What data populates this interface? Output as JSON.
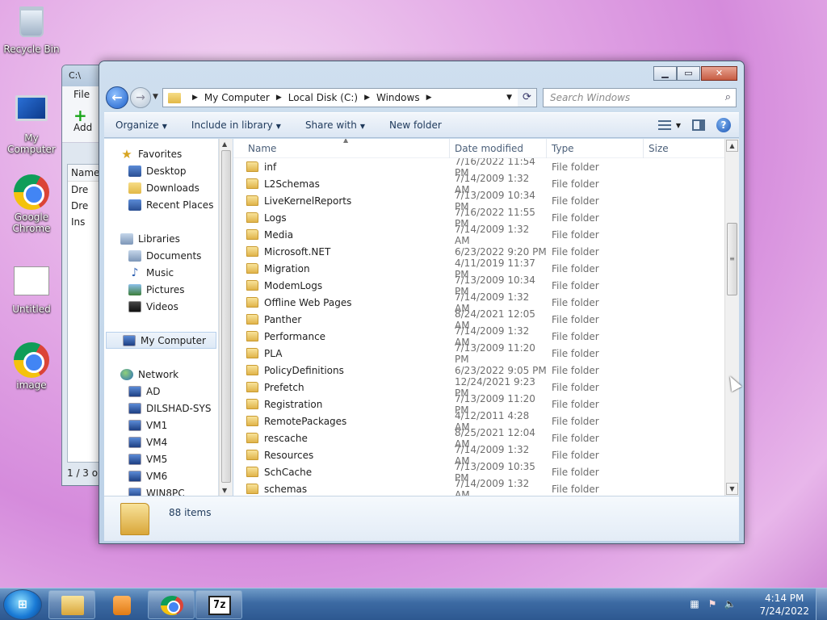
{
  "desktop": {
    "icons": [
      {
        "label": "Recycle Bin",
        "icon": "recycle-bin-icon"
      },
      {
        "label": "My Computer",
        "icon": "computer-icon"
      },
      {
        "label": "Google Chrome",
        "icon": "chrome-icon"
      },
      {
        "label": "Untitled",
        "icon": "document-icon"
      },
      {
        "label": "image",
        "icon": "chrome-icon"
      }
    ]
  },
  "backWindow": {
    "title": "C:\\",
    "menu": "File",
    "addLabel": "Add",
    "listHeader": "Name",
    "items": [
      "Dre",
      "Dre",
      "Ins"
    ],
    "status": "1 / 3 ob"
  },
  "explorer": {
    "address": {
      "crumbs": [
        "My Computer",
        "Local Disk (C:)",
        "Windows"
      ]
    },
    "search": {
      "placeholder": "Search Windows"
    },
    "commands": [
      "Organize",
      "Include in library",
      "Share with",
      "New folder"
    ],
    "nav": {
      "favorites": {
        "label": "Favorites",
        "items": [
          "Desktop",
          "Downloads",
          "Recent Places"
        ]
      },
      "libraries": {
        "label": "Libraries",
        "items": [
          "Documents",
          "Music",
          "Pictures",
          "Videos"
        ]
      },
      "computer": {
        "label": "My Computer"
      },
      "network": {
        "label": "Network",
        "items": [
          "AD",
          "DILSHAD-SYS",
          "VM1",
          "VM4",
          "VM5",
          "VM6",
          "WIN8PC"
        ]
      }
    },
    "columns": {
      "name": "Name",
      "date": "Date modified",
      "type": "Type",
      "size": "Size"
    },
    "files": [
      {
        "name": "inf",
        "date": "7/16/2022 11:54 PM",
        "type": "File folder"
      },
      {
        "name": "L2Schemas",
        "date": "7/14/2009 1:32 AM",
        "type": "File folder"
      },
      {
        "name": "LiveKernelReports",
        "date": "7/13/2009 10:34 PM",
        "type": "File folder"
      },
      {
        "name": "Logs",
        "date": "7/16/2022 11:55 PM",
        "type": "File folder"
      },
      {
        "name": "Media",
        "date": "7/14/2009 1:32 AM",
        "type": "File folder"
      },
      {
        "name": "Microsoft.NET",
        "date": "6/23/2022 9:20 PM",
        "type": "File folder"
      },
      {
        "name": "Migration",
        "date": "4/11/2019 11:37 PM",
        "type": "File folder"
      },
      {
        "name": "ModemLogs",
        "date": "7/13/2009 10:34 PM",
        "type": "File folder"
      },
      {
        "name": "Offline Web Pages",
        "date": "7/14/2009 1:32 AM",
        "type": "File folder"
      },
      {
        "name": "Panther",
        "date": "8/24/2021 12:05 AM",
        "type": "File folder"
      },
      {
        "name": "Performance",
        "date": "7/14/2009 1:32 AM",
        "type": "File folder"
      },
      {
        "name": "PLA",
        "date": "7/13/2009 11:20 PM",
        "type": "File folder"
      },
      {
        "name": "PolicyDefinitions",
        "date": "6/23/2022 9:05 PM",
        "type": "File folder"
      },
      {
        "name": "Prefetch",
        "date": "12/24/2021 9:23 PM",
        "type": "File folder"
      },
      {
        "name": "Registration",
        "date": "7/13/2009 11:20 PM",
        "type": "File folder"
      },
      {
        "name": "RemotePackages",
        "date": "4/12/2011 4:28 AM",
        "type": "File folder"
      },
      {
        "name": "rescache",
        "date": "8/25/2021 12:04 AM",
        "type": "File folder"
      },
      {
        "name": "Resources",
        "date": "7/14/2009 1:32 AM",
        "type": "File folder"
      },
      {
        "name": "SchCache",
        "date": "7/13/2009 10:35 PM",
        "type": "File folder"
      },
      {
        "name": "schemas",
        "date": "7/14/2009 1:32 AM",
        "type": "File folder"
      }
    ],
    "status": {
      "count": "88 items"
    }
  },
  "taskbar": {
    "buttons": [
      "explorer-icon",
      "media-player-icon",
      "chrome-icon",
      "7zip-icon"
    ],
    "time": "4:14 PM",
    "date": "7/24/2022"
  }
}
